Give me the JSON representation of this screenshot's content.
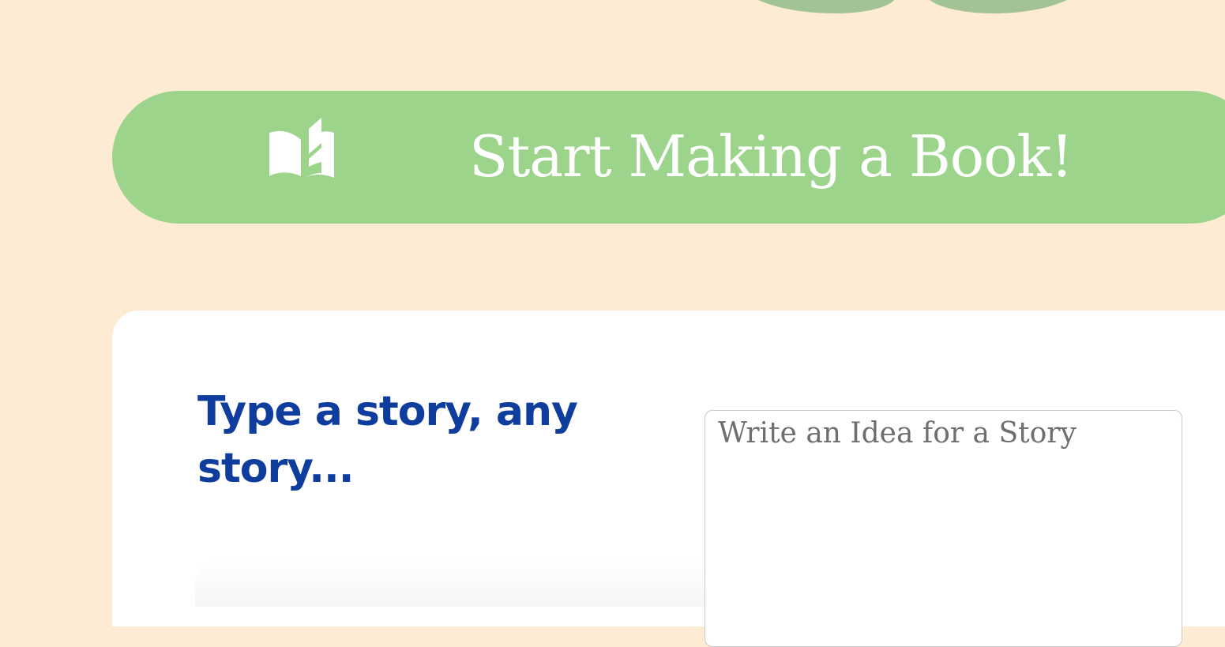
{
  "colors": {
    "page_background": "#FDEBD3",
    "button_green": "#9DD48C",
    "decor_green": "#A2C494",
    "heading_blue": "#0E3D9E",
    "card_background": "#FFFFFF"
  },
  "cta": {
    "icon": "open-book-icon",
    "label": "Start Making a Book!"
  },
  "story_section": {
    "heading": "Type a story, any story...",
    "idea_input": {
      "placeholder": "Write an Idea for a Story",
      "value": ""
    }
  }
}
